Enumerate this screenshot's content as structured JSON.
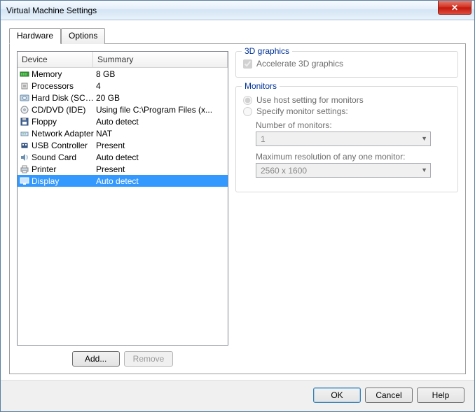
{
  "window": {
    "title": "Virtual Machine Settings"
  },
  "tabs": {
    "hardware": "Hardware",
    "options": "Options"
  },
  "list": {
    "header_device": "Device",
    "header_summary": "Summary",
    "items": [
      {
        "name": "Memory",
        "summary": "8 GB",
        "icon": "memory"
      },
      {
        "name": "Processors",
        "summary": "4",
        "icon": "cpu"
      },
      {
        "name": "Hard Disk (SCSI)",
        "summary": "20 GB",
        "icon": "hdd"
      },
      {
        "name": "CD/DVD (IDE)",
        "summary": "Using file C:\\Program Files (x...",
        "icon": "cd"
      },
      {
        "name": "Floppy",
        "summary": "Auto detect",
        "icon": "floppy"
      },
      {
        "name": "Network Adapter",
        "summary": "NAT",
        "icon": "net"
      },
      {
        "name": "USB Controller",
        "summary": "Present",
        "icon": "usb"
      },
      {
        "name": "Sound Card",
        "summary": "Auto detect",
        "icon": "sound"
      },
      {
        "name": "Printer",
        "summary": "Present",
        "icon": "printer"
      },
      {
        "name": "Display",
        "summary": "Auto detect",
        "icon": "display",
        "selected": true
      }
    ],
    "add_btn": "Add...",
    "remove_btn": "Remove"
  },
  "graphics3d": {
    "title": "3D graphics",
    "accel_label": "Accelerate 3D graphics",
    "accel_checked": true
  },
  "monitors": {
    "title": "Monitors",
    "use_host_label": "Use host setting for monitors",
    "specify_label": "Specify monitor settings:",
    "num_label": "Number of monitors:",
    "num_value": "1",
    "maxres_label": "Maximum resolution of any one monitor:",
    "maxres_value": "2560 x 1600"
  },
  "footer": {
    "ok": "OK",
    "cancel": "Cancel",
    "help": "Help"
  }
}
